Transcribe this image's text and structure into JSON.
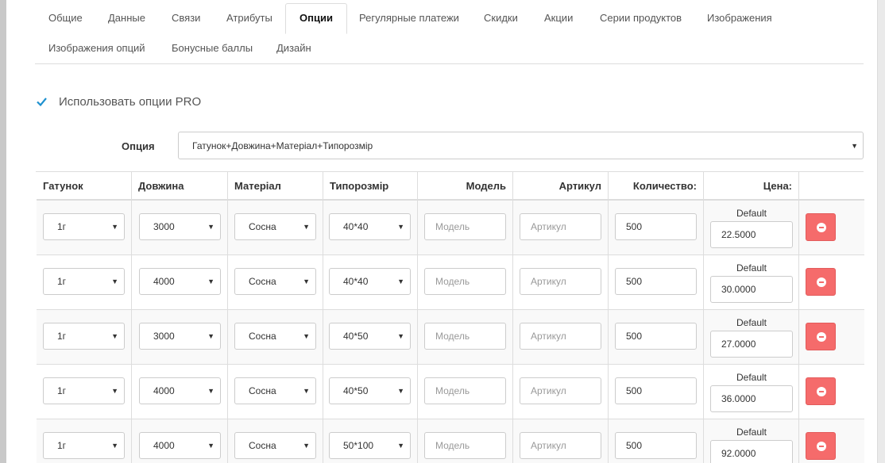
{
  "tabs": [
    {
      "label": "Общие"
    },
    {
      "label": "Данные"
    },
    {
      "label": "Связи"
    },
    {
      "label": "Атрибуты"
    },
    {
      "label": "Опции",
      "active": true
    },
    {
      "label": "Регулярные платежи"
    },
    {
      "label": "Скидки"
    },
    {
      "label": "Акции"
    },
    {
      "label": "Серии продуктов"
    },
    {
      "label": "Изображения"
    },
    {
      "label": "Изображения опций"
    },
    {
      "label": "Бонусные баллы"
    },
    {
      "label": "Дизайн"
    }
  ],
  "pro": {
    "label": "Использовать опции PRO",
    "checked": true
  },
  "option": {
    "label": "Опция",
    "value": "Гатунок+Довжина+Матеріал+Типорозмір"
  },
  "table": {
    "headers": [
      "Гатунок",
      "Довжина",
      "Матеріал",
      "Типорозмір",
      "Модель",
      "Артикул",
      "Количество:",
      "Цена:"
    ],
    "placeholders": {
      "model": "Модель",
      "sku": "Артикул"
    },
    "price_label": "Default",
    "rows": [
      {
        "grade": "1г",
        "length": "3000",
        "material": "Сосна",
        "size": "40*40",
        "qty": "500",
        "price": "22.5000"
      },
      {
        "grade": "1г",
        "length": "4000",
        "material": "Сосна",
        "size": "40*40",
        "qty": "500",
        "price": "30.0000"
      },
      {
        "grade": "1г",
        "length": "3000",
        "material": "Сосна",
        "size": "40*50",
        "qty": "500",
        "price": "27.0000"
      },
      {
        "grade": "1г",
        "length": "4000",
        "material": "Сосна",
        "size": "40*50",
        "qty": "500",
        "price": "36.0000"
      },
      {
        "grade": "1г",
        "length": "4000",
        "material": "Сосна",
        "size": "50*100",
        "qty": "500",
        "price": "92.0000"
      }
    ]
  },
  "colors": {
    "accent": "#1e91cf",
    "danger": "#f56b6b"
  },
  "icons": {
    "check": "checkmark-icon",
    "caret": "caret-down-icon",
    "remove": "minus-circle-icon"
  }
}
